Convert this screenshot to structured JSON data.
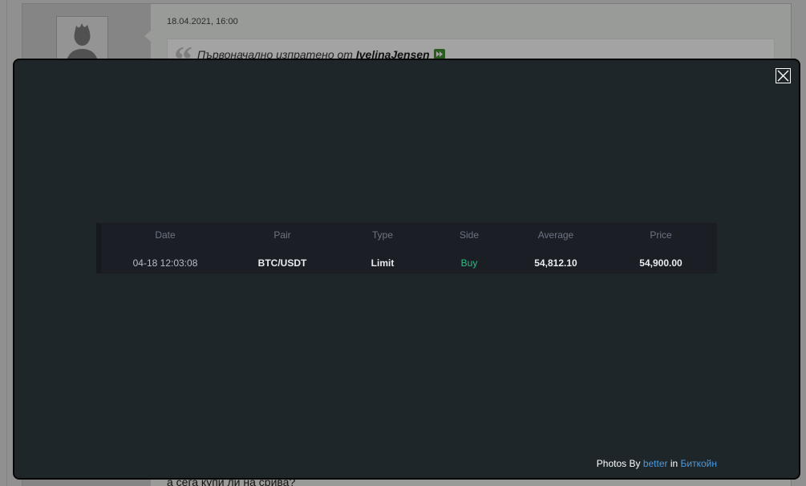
{
  "forum_post": {
    "timestamp": "18.04.2021, 16:00",
    "quote": {
      "prefix": "Първоначално изпратено от",
      "author": "IvelinaJensen"
    },
    "message": "а сега купи ли на срива?"
  },
  "lightbox": {
    "image": {
      "headers": [
        "Date",
        "Pair",
        "Type",
        "Side",
        "Average",
        "Price"
      ],
      "rows": [
        [
          "04-18 12:03:08",
          "BTC/USDT",
          "Limit",
          "Buy",
          "54,812.10",
          "54,900.00"
        ]
      ]
    },
    "caption": {
      "prefix": "Photos By",
      "user": "better",
      "connector": "in",
      "album": "Биткойн"
    }
  },
  "icons": {
    "avatar": "avatar-placeholder-icon",
    "quote": "quote-mark-icon",
    "view_post": "view-post-icon",
    "close": "close-icon"
  },
  "colors": {
    "modal_background": "#1f2629",
    "buy": "#2ebd85",
    "link": "#4a9ae0",
    "view_post_icon": "#3f8f2f",
    "overlay": "rgba(0,0,0,0.35)"
  }
}
